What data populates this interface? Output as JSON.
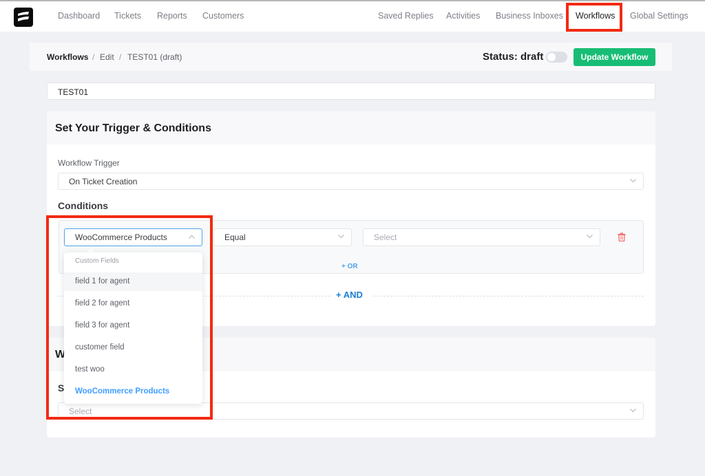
{
  "topnav": {
    "left": [
      "Dashboard",
      "Tickets",
      "Reports",
      "Customers"
    ],
    "right": [
      "Saved Replies",
      "Activities",
      "Business Inboxes",
      "Workflows",
      "Global Settings"
    ],
    "active": "Workflows"
  },
  "breadcrumb": {
    "root": "Workflows",
    "sep": "/",
    "edit": "Edit",
    "current": "TEST01 (draft)"
  },
  "status": {
    "label": "Status: draft",
    "toggle_on": false
  },
  "update_button": "Update Workflow",
  "workflow_name": "TEST01",
  "trigger_card": {
    "title": "Set Your Trigger & Conditions",
    "trigger_label": "Workflow Trigger",
    "trigger_value": "On Ticket Creation",
    "conditions_heading": "Conditions",
    "condition": {
      "field": "WooCommerce Products",
      "operator": "Equal",
      "value_placeholder": "Select"
    },
    "or_label": "+ OR",
    "and_label": "+ AND"
  },
  "dropdown": {
    "group_label": "Custom Fields",
    "items": [
      "field 1 for agent",
      "field 2 for agent",
      "field 3 for agent",
      "customer field",
      "test woo",
      "WooCommerce Products"
    ],
    "hovered": "field 1 for agent",
    "selected": "WooCommerce Products"
  },
  "action_card": {
    "title_partial": "W",
    "label_partial": "S",
    "select_placeholder": "Select"
  },
  "colors": {
    "primary_button": "#18bd75",
    "link_blue": "#1a7fd4",
    "selected_blue": "#409eff",
    "annotation_red": "#f22a12",
    "delete_red": "#f56c6c"
  }
}
